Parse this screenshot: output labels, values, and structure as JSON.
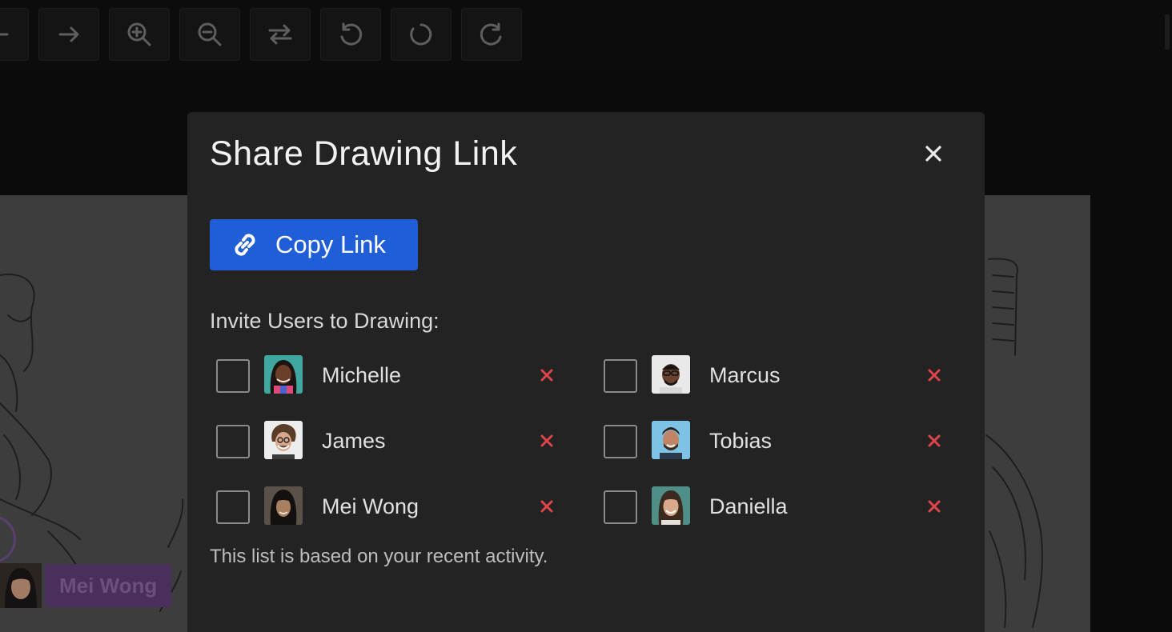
{
  "toolbar": {
    "buttons": [
      {
        "name": "back-arrow-icon"
      },
      {
        "name": "forward-arrow-icon"
      },
      {
        "name": "zoom-in-icon"
      },
      {
        "name": "zoom-out-icon"
      },
      {
        "name": "swap-icon"
      },
      {
        "name": "undo-icon"
      },
      {
        "name": "reset-icon"
      },
      {
        "name": "redo-icon"
      }
    ]
  },
  "canvas": {
    "cursor_user": "Mei Wong",
    "cursor_color": "#4a2f5c"
  },
  "modal": {
    "title": "Share Drawing Link",
    "close_icon": "close-icon",
    "copy_button_label": "Copy Link",
    "copy_button_icon": "link-icon",
    "invite_heading": "Invite Users to Drawing:",
    "users": [
      {
        "name": "Michelle",
        "checked": false
      },
      {
        "name": "Marcus",
        "checked": false
      },
      {
        "name": "James",
        "checked": false
      },
      {
        "name": "Tobias",
        "checked": false
      },
      {
        "name": "Mei Wong",
        "checked": false
      },
      {
        "name": "Daniella",
        "checked": false
      }
    ],
    "footnote": "This list is based on your recent activity.",
    "accent_color": "#1f5ed6",
    "remove_color": "#e0444b"
  }
}
